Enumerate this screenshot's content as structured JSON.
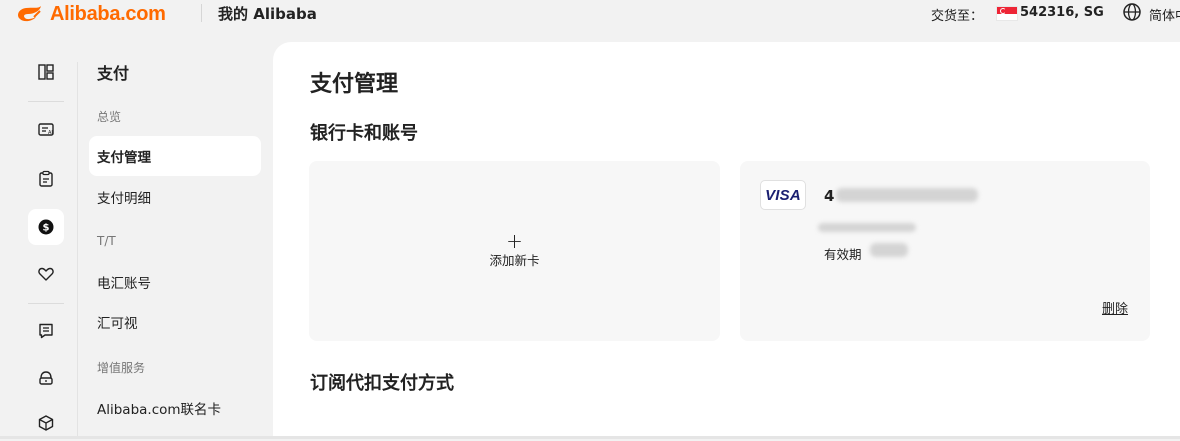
{
  "header": {
    "brand": "Alibaba.com",
    "my_alibaba": "我的 Alibaba",
    "ship_to_label": "交货至：",
    "ship_to_value": "542316, SG",
    "language": "简体中"
  },
  "rail": {
    "icons": [
      "dashboard-icon",
      "rfq-icon",
      "orders-icon",
      "payment-icon",
      "favorites-icon",
      "messages-icon",
      "buyer-icon",
      "logistics-icon"
    ],
    "active": "payment-icon"
  },
  "subnav": {
    "title": "支付",
    "groups": [
      {
        "label": "总览",
        "items": [
          "支付管理",
          "支付明细"
        ]
      },
      {
        "label": "T/T",
        "items": [
          "电汇账号",
          "汇可视"
        ]
      },
      {
        "label": "增值服务",
        "items": [
          "Alibaba.com联名卡"
        ]
      }
    ],
    "active_item": "支付管理"
  },
  "main": {
    "page_title": "支付管理",
    "cards_section_title": "银行卡和账号",
    "add_card": {
      "plus": "+",
      "label": "添加新卡"
    },
    "saved_card": {
      "brand": "VISA",
      "number_prefix": "4",
      "expiry_label": "有效期",
      "delete_label": "删除"
    },
    "subscription_section_title": "订阅代扣支付方式"
  },
  "colors": {
    "brand_orange": "#ff6a00",
    "visa_blue": "#1a1f71",
    "page_bg": "#f2f2f2",
    "card_bg": "#f7f7f7"
  }
}
